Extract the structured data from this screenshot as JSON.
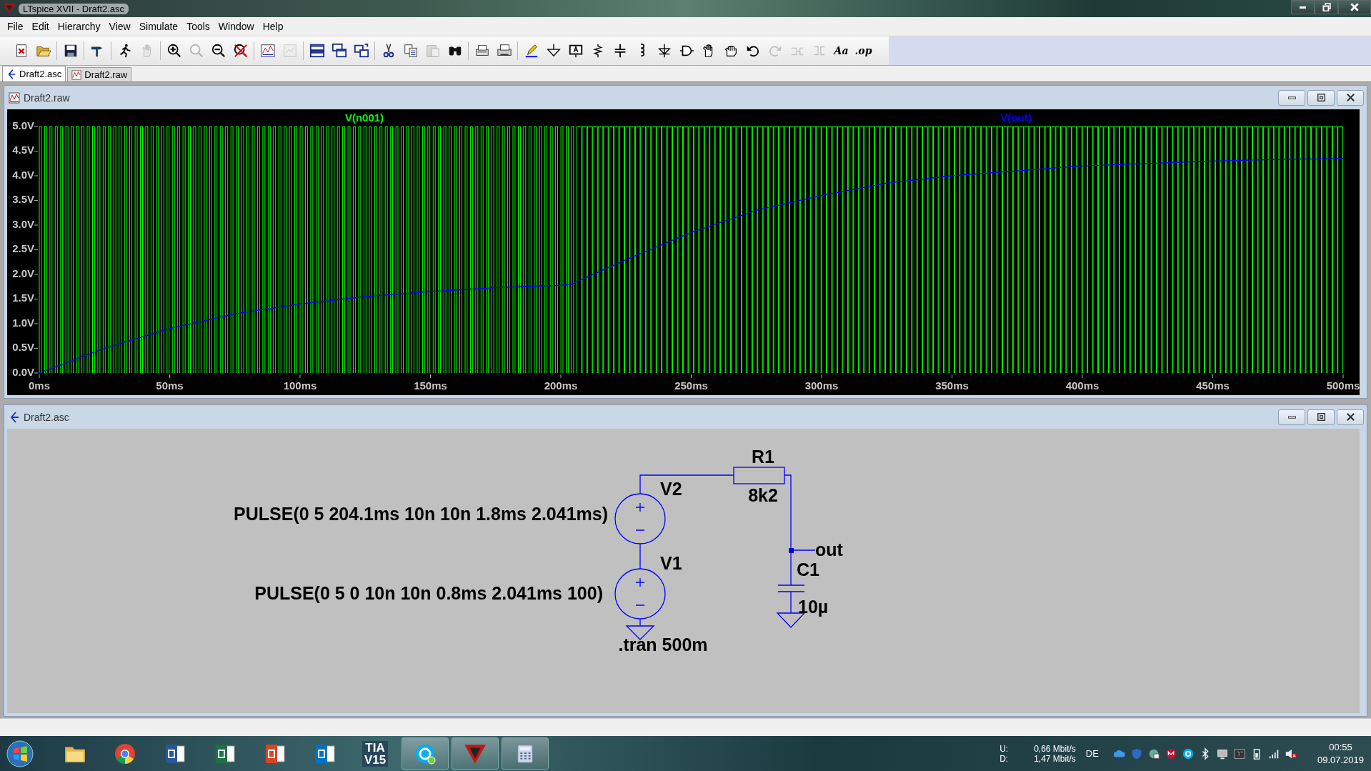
{
  "window": {
    "title": "LTspice XVII - Draft2.asc"
  },
  "menu": [
    "File",
    "Edit",
    "Hierarchy",
    "View",
    "Simulate",
    "Tools",
    "Window",
    "Help"
  ],
  "toolbar": [
    {
      "disabled": false
    },
    {
      "disabled": false
    },
    {
      "disabled": false
    },
    {
      "disabled": false
    },
    {
      "disabled": false
    },
    {
      "disabled": true
    },
    {
      "disabled": false
    },
    {
      "disabled": true
    },
    {
      "disabled": false
    },
    {
      "disabled": false
    },
    {
      "disabled": false
    },
    {
      "disabled": true
    },
    {
      "disabled": false
    },
    {
      "disabled": false
    },
    {
      "disabled": false
    },
    {
      "disabled": false
    },
    {
      "disabled": false
    },
    {
      "disabled": true
    },
    {
      "disabled": false
    },
    {
      "disabled": false
    },
    {
      "disabled": false
    },
    {
      "disabled": false
    },
    {
      "disabled": false
    },
    {
      "disabled": false
    },
    {
      "disabled": false
    },
    {
      "disabled": false
    },
    {
      "disabled": false
    },
    {
      "disabled": false
    },
    {
      "disabled": false
    },
    {
      "disabled": false
    },
    {
      "disabled": false
    },
    {
      "disabled": false
    },
    {
      "disabled": true
    },
    {
      "disabled": true
    },
    {
      "disabled": true
    },
    {
      "label": "Aa",
      "disabled": false
    },
    {
      "label": ".op",
      "disabled": false
    }
  ],
  "tabs": [
    {
      "label": "Draft2.asc",
      "kind": "schematic",
      "selected": true
    },
    {
      "label": "Draft2.raw",
      "kind": "waveform",
      "selected": false
    }
  ],
  "plot_window": {
    "title": "Draft2.raw",
    "pulse_trace": {
      "name": "V(n001)",
      "color": "#00ff00"
    },
    "chart_data": {
      "type": "line",
      "x": [
        0,
        25,
        50,
        75,
        100,
        125,
        150,
        175,
        200,
        204,
        225,
        250,
        275,
        300,
        325,
        350,
        375,
        400,
        425,
        450,
        475,
        500
      ],
      "series": [
        {
          "name": "V(out)",
          "color": "#0000ff",
          "values": [
            0,
            0.5,
            0.9,
            1.2,
            1.4,
            1.55,
            1.65,
            1.73,
            1.78,
            1.8,
            2.3,
            2.85,
            3.3,
            3.6,
            3.85,
            4.0,
            4.1,
            4.2,
            4.25,
            4.3,
            4.33,
            4.35
          ]
        }
      ],
      "xlim": [
        0,
        500
      ],
      "ylim": [
        0,
        5
      ],
      "xticks": [
        {
          "value": 0,
          "label": "0ms"
        },
        {
          "value": 50,
          "label": "50ms"
        },
        {
          "value": 100,
          "label": "100ms"
        },
        {
          "value": 150,
          "label": "150ms"
        },
        {
          "value": 200,
          "label": "200ms"
        },
        {
          "value": 250,
          "label": "250ms"
        },
        {
          "value": 300,
          "label": "300ms"
        },
        {
          "value": 350,
          "label": "350ms"
        },
        {
          "value": 400,
          "label": "400ms"
        },
        {
          "value": 450,
          "label": "450ms"
        },
        {
          "value": 500,
          "label": "500ms"
        }
      ],
      "yticks": [
        {
          "value": 0,
          "label": "0.0V"
        },
        {
          "value": 0.5,
          "label": "0.5V"
        },
        {
          "value": 1,
          "label": "1.0V"
        },
        {
          "value": 1.5,
          "label": "1.5V"
        },
        {
          "value": 2,
          "label": "2.0V"
        },
        {
          "value": 2.5,
          "label": "2.5V"
        },
        {
          "value": 3,
          "label": "3.0V"
        },
        {
          "value": 3.5,
          "label": "3.5V"
        },
        {
          "value": 4,
          "label": "4.0V"
        },
        {
          "value": 4.5,
          "label": "4.5V"
        },
        {
          "value": 5,
          "label": "5.0V"
        }
      ]
    }
  },
  "schematic_window": {
    "title": "Draft2.asc",
    "sources": [
      {
        "ref": "V2",
        "value": "PULSE(0 5 204.1ms 10n 10n 1.8ms 2.041ms)"
      },
      {
        "ref": "V1",
        "value": "PULSE(0 5 0 10n 10n 0.8ms 2.041ms 100)"
      }
    ],
    "resistor": {
      "ref": "R1",
      "value": "8k2"
    },
    "capacitor": {
      "ref": "C1",
      "value": "10µ"
    },
    "net_label": "out",
    "directive": ".tran 500m"
  },
  "taskbar": {
    "apps": [
      {
        "kind": "explorer",
        "running": false
      },
      {
        "kind": "chrome",
        "running": false
      },
      {
        "kind": "word",
        "running": false
      },
      {
        "kind": "excel",
        "running": false
      },
      {
        "kind": "powerpoint",
        "running": false
      },
      {
        "kind": "outlook",
        "running": false
      },
      {
        "kind": "tia",
        "label": "TIA",
        "sublabel": "V15",
        "running": false
      },
      {
        "kind": "skype",
        "running": true
      },
      {
        "kind": "ltspice",
        "running": true
      },
      {
        "kind": "calculator",
        "running": true
      }
    ],
    "network": {
      "up_label": "U:",
      "down_label": "D:",
      "up": "0,66 Mbit/s",
      "down": "1,47 Mbit/s"
    },
    "language": "DE",
    "time": "00:55",
    "date": "09.07.2019"
  }
}
